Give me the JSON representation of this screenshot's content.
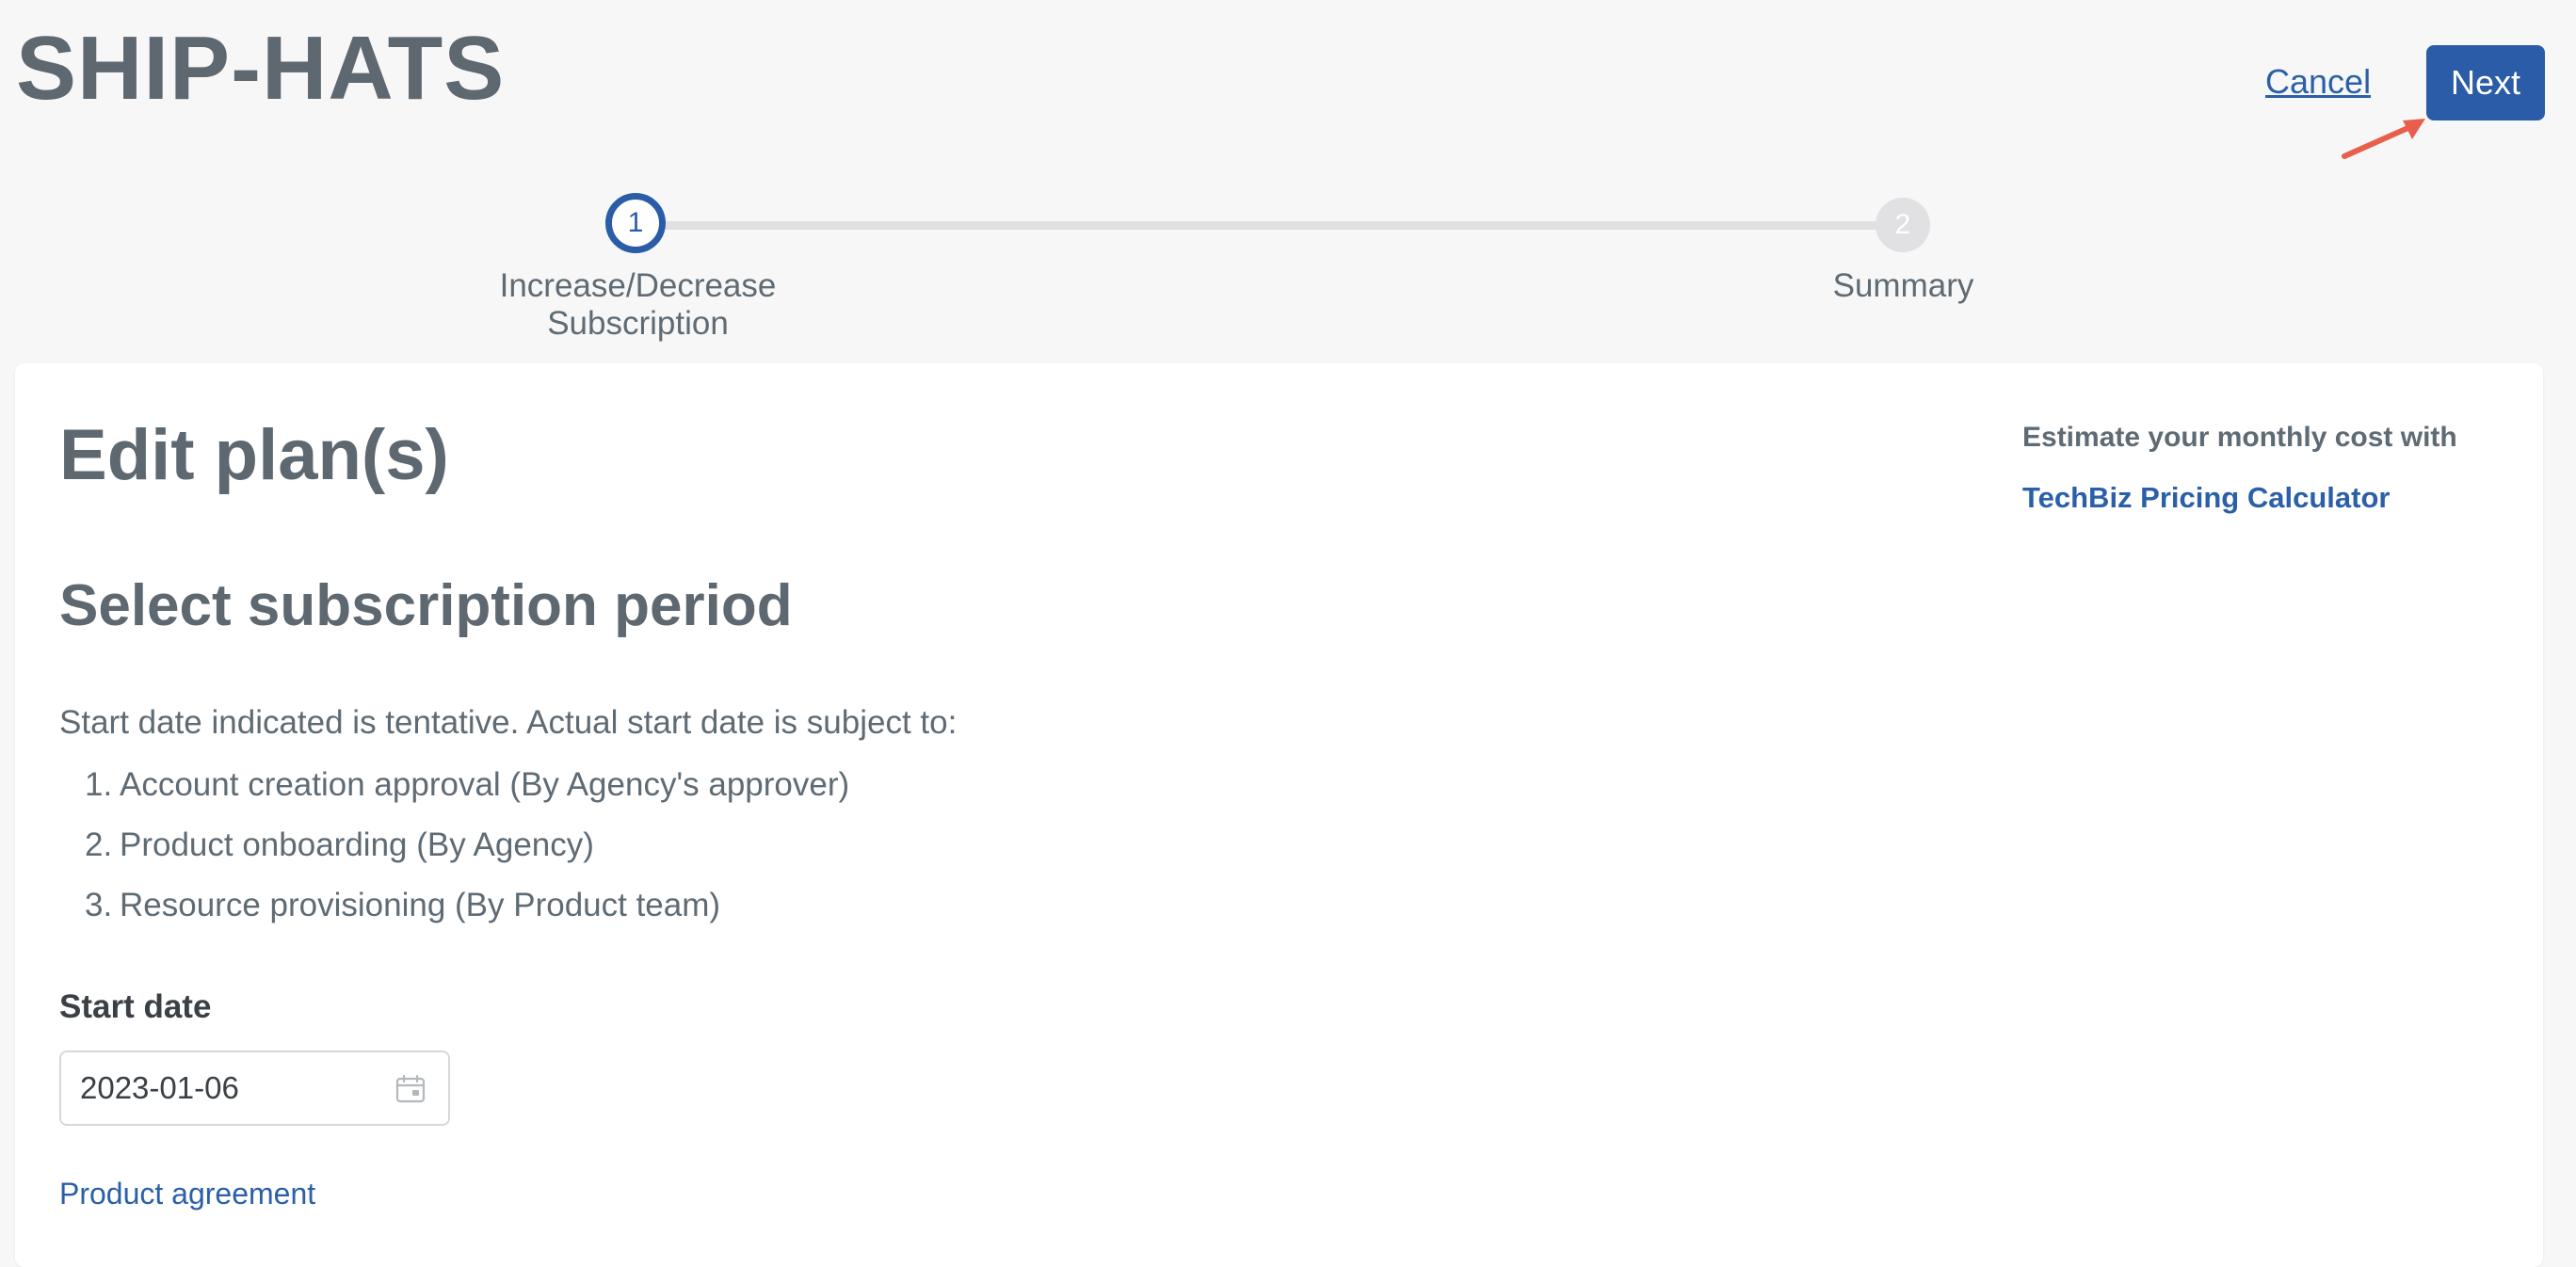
{
  "header": {
    "app_title": "SHIP-HATS",
    "cancel_label": "Cancel",
    "next_label": "Next"
  },
  "stepper": {
    "steps": [
      {
        "number": "1",
        "label": "Increase/Decrease Subscription",
        "state": "active"
      },
      {
        "number": "2",
        "label": "Summary",
        "state": "inactive"
      }
    ]
  },
  "main": {
    "page_title": "Edit plan(s)",
    "section_title": "Select subscription period",
    "intro_text": "Start date indicated is tentative. Actual start date is subject to:",
    "conditions": [
      {
        "num": "1.",
        "text": "Account creation approval (By Agency's approver)"
      },
      {
        "num": "2.",
        "text": "Product onboarding (By Agency)"
      },
      {
        "num": "3.",
        "text": "Resource provisioning (By Product team)"
      }
    ],
    "start_date_label": "Start date",
    "start_date_value": "2023-01-06",
    "product_agreement_label": "Product agreement"
  },
  "aside": {
    "estimate_text": "Estimate your monthly cost with",
    "calculator_link": "TechBiz Pricing Calculator"
  },
  "colors": {
    "accent": "#2a5ca8",
    "link": "#2b5fa8",
    "heading": "#5e6870",
    "background": "#f7f7f8",
    "annotation_arrow": "#e8604c"
  },
  "icons": {
    "date_field": "calendar-icon",
    "annotation": "arrow-icon"
  }
}
